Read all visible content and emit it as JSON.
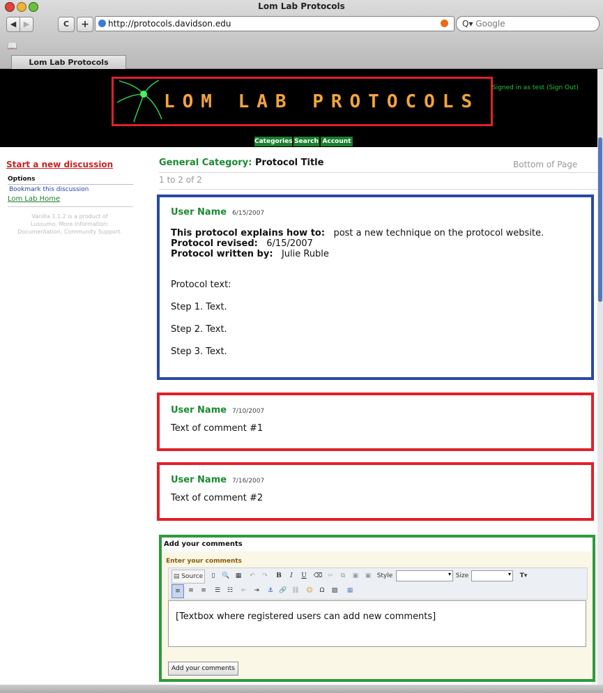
{
  "browser": {
    "window_title": "Lom Lab Protocols",
    "url": "http://protocols.davidson.edu",
    "search_placeholder": "Google",
    "tab_label": "Lom Lab Protocols",
    "back_label": "◀",
    "forward_label": "▶",
    "reload_label": "C",
    "add_label": "+",
    "bookmarks_icon": "book-icon"
  },
  "banner": {
    "logo_text": "LOM LAB PROTOCOLS",
    "signed_in": "Signed in as test (Sign Out)",
    "nav": [
      "Categories",
      "Search",
      "Account"
    ]
  },
  "sidebar": {
    "start_discussion": "Start a new discussion",
    "options": "Options",
    "bookmark": "Bookmark this discussion",
    "home": "Lom Lab Home",
    "vanilla_line1": "Vanilla 1.1.2 is a product of",
    "vanilla_line2": "Lussumo. More Information:",
    "vanilla_line3": "Documentation, Community Support."
  },
  "discussion": {
    "category_label": "General Category:",
    "title": "Protocol Title",
    "bottom_link": "Bottom of Page",
    "count": "1 to 2 of 2"
  },
  "post": {
    "user": "User Name",
    "date": "6/15/2007",
    "explains_label": "This protocol explains how to:",
    "explains_value": "post a new technique on the protocol website.",
    "revised_label": "Protocol revised:",
    "revised_value": "6/15/2007",
    "written_label": "Protocol written by:",
    "written_value": "Julie Ruble",
    "text_label": "Protocol text:",
    "steps": [
      "Step 1.  Text.",
      "Step 2.  Text.",
      "Step 3.  Text."
    ]
  },
  "comments": [
    {
      "user": "User Name",
      "date": "7/10/2007",
      "text": "Text of comment #1"
    },
    {
      "user": "User Name",
      "date": "7/16/2007",
      "text": "Text of comment #2"
    }
  ],
  "comment_form": {
    "title": "Add your comments",
    "enter_label": "Enter your comments",
    "source_label": "Source",
    "style_label": "Style",
    "size_label": "Size",
    "textbox_text": "[Textbox where registered users can add new comments]",
    "submit_label": "Add your comments"
  }
}
